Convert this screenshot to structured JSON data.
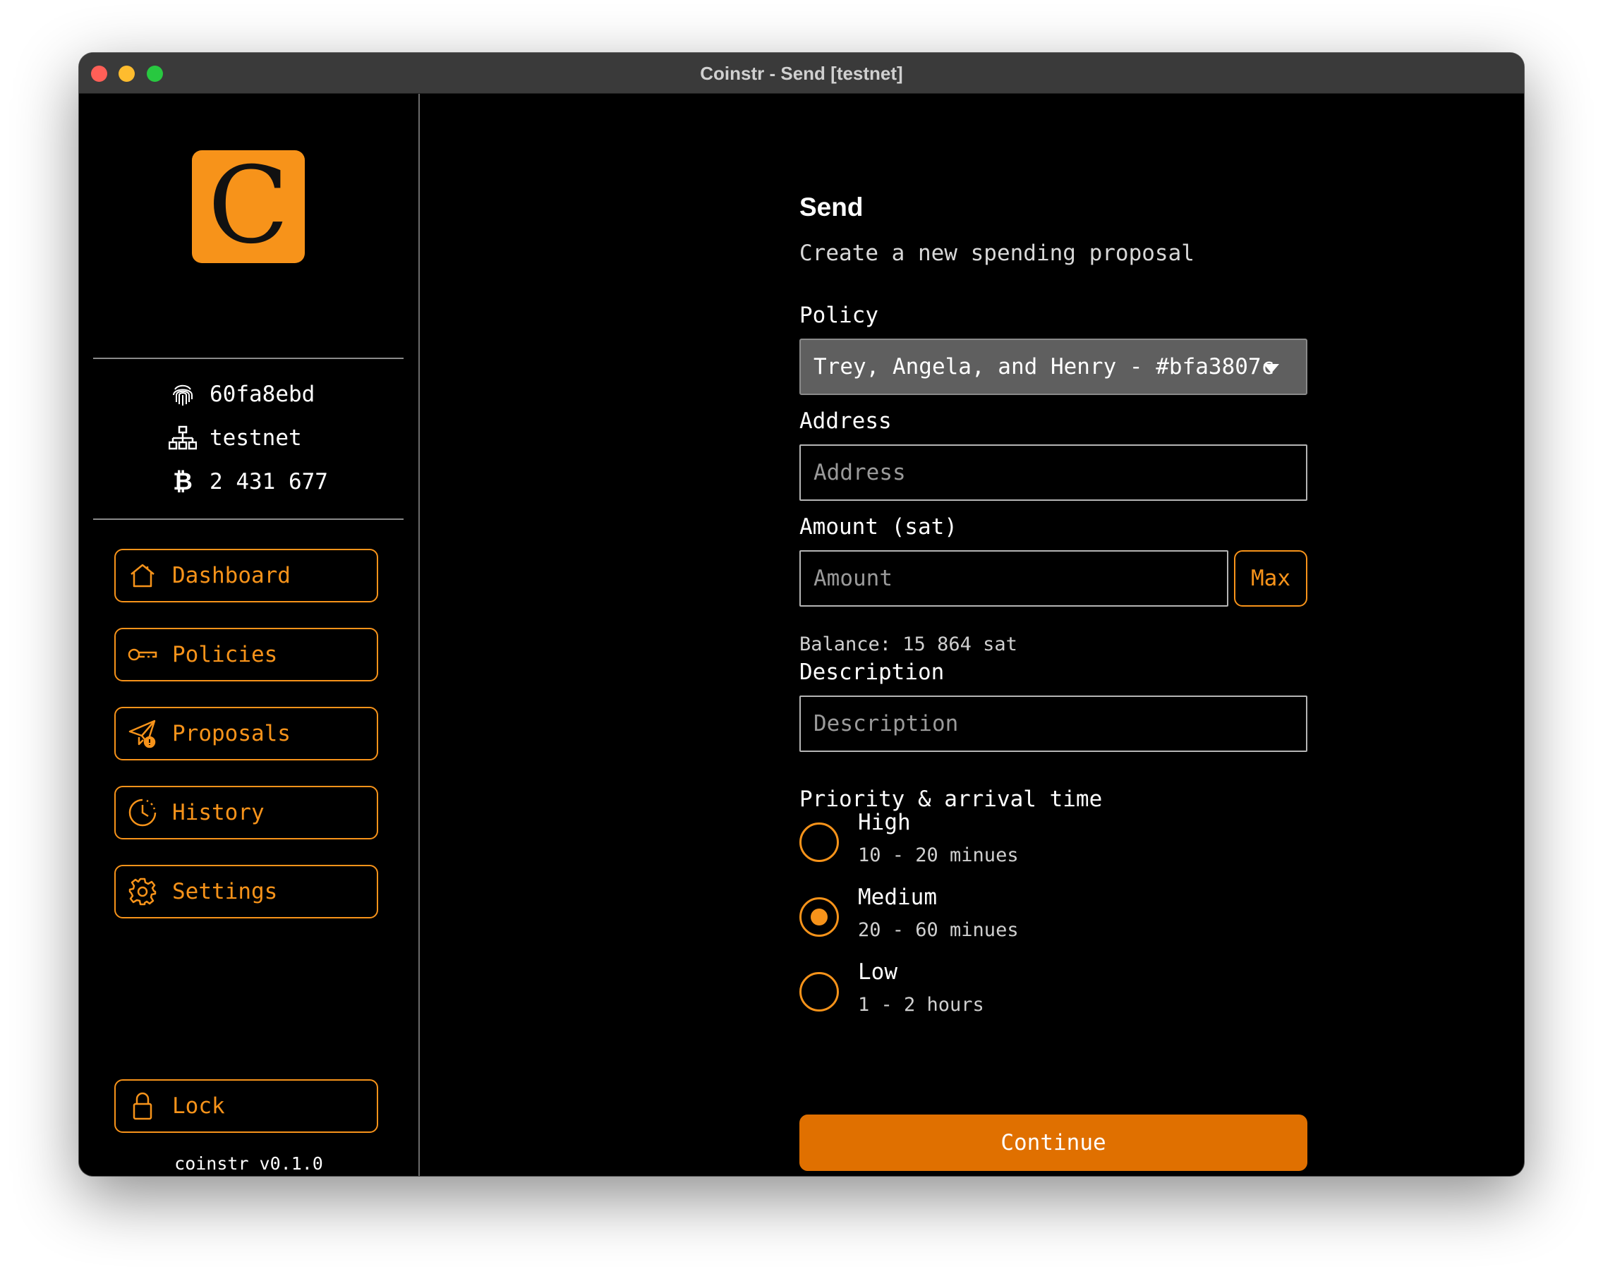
{
  "window": {
    "title": "Coinstr - Send [testnet]"
  },
  "logo": {
    "letter": "C"
  },
  "sidebar": {
    "info": {
      "fingerprint": "60fa8ebd",
      "network": "testnet",
      "balance": "2 431 677"
    },
    "nav": [
      {
        "label": "Dashboard",
        "icon": "house-icon"
      },
      {
        "label": "Policies",
        "icon": "key-icon"
      },
      {
        "label": "Proposals",
        "icon": "send-alert-icon"
      },
      {
        "label": "History",
        "icon": "clock-icon"
      },
      {
        "label": "Settings",
        "icon": "gear-icon"
      }
    ],
    "lock_label": "Lock",
    "version": "coinstr v0.1.0"
  },
  "form": {
    "title": "Send",
    "subtitle": "Create a new spending proposal",
    "policy_label": "Policy",
    "policy_value": "Trey, Angela, and Henry - #bfa3807c",
    "address_label": "Address",
    "address_placeholder": "Address",
    "amount_label": "Amount (sat)",
    "amount_placeholder": "Amount",
    "max_label": "Max",
    "balance_text": "Balance: 15 864 sat",
    "description_label": "Description",
    "description_placeholder": "Description",
    "priority_label": "Priority & arrival time",
    "priorities": [
      {
        "title": "High",
        "subtitle": "10 - 20 minues",
        "selected": false
      },
      {
        "title": "Medium",
        "subtitle": "20 - 60 minues",
        "selected": true
      },
      {
        "title": "Low",
        "subtitle": "1 - 2 hours",
        "selected": false
      }
    ],
    "continue_label": "Continue"
  },
  "colors": {
    "accent": "#f7931a",
    "button": "#e07000",
    "background": "#000000"
  }
}
